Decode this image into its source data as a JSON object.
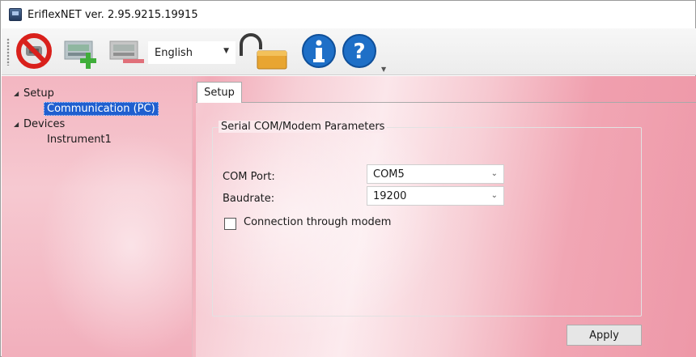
{
  "window": {
    "title": "EriflexNET ver. 2.95.9215.19915"
  },
  "toolbar": {
    "disconnect_icon": "no-entry-serial-icon",
    "add_device_icon": "add-device-icon",
    "remove_device_icon": "remove-device-icon",
    "language": "English",
    "lock_icon": "open-padlock-icon",
    "info_icon": "info-icon",
    "help_icon": "help-icon"
  },
  "tree": {
    "items": [
      {
        "label": "Setup",
        "level": 0,
        "expanded": true
      },
      {
        "label": "Communication (PC)",
        "level": 1,
        "selected": true
      },
      {
        "label": "Devices",
        "level": 0,
        "expanded": true
      },
      {
        "label": "Instrument1",
        "level": 1
      }
    ]
  },
  "tabs": [
    {
      "label": "Setup",
      "active": true
    }
  ],
  "serial_group": {
    "title": "Serial COM/Modem Parameters",
    "com_port_label": "COM Port:",
    "com_port_value": "COM5",
    "baudrate_label": "Baudrate:",
    "baudrate_value": "19200",
    "modem_checkbox_label": "Connection through modem",
    "modem_checked": false
  },
  "actions": {
    "apply_label": "Apply"
  },
  "colors": {
    "selection": "#1f5fcf",
    "background_pink": "#f2b9c3"
  }
}
